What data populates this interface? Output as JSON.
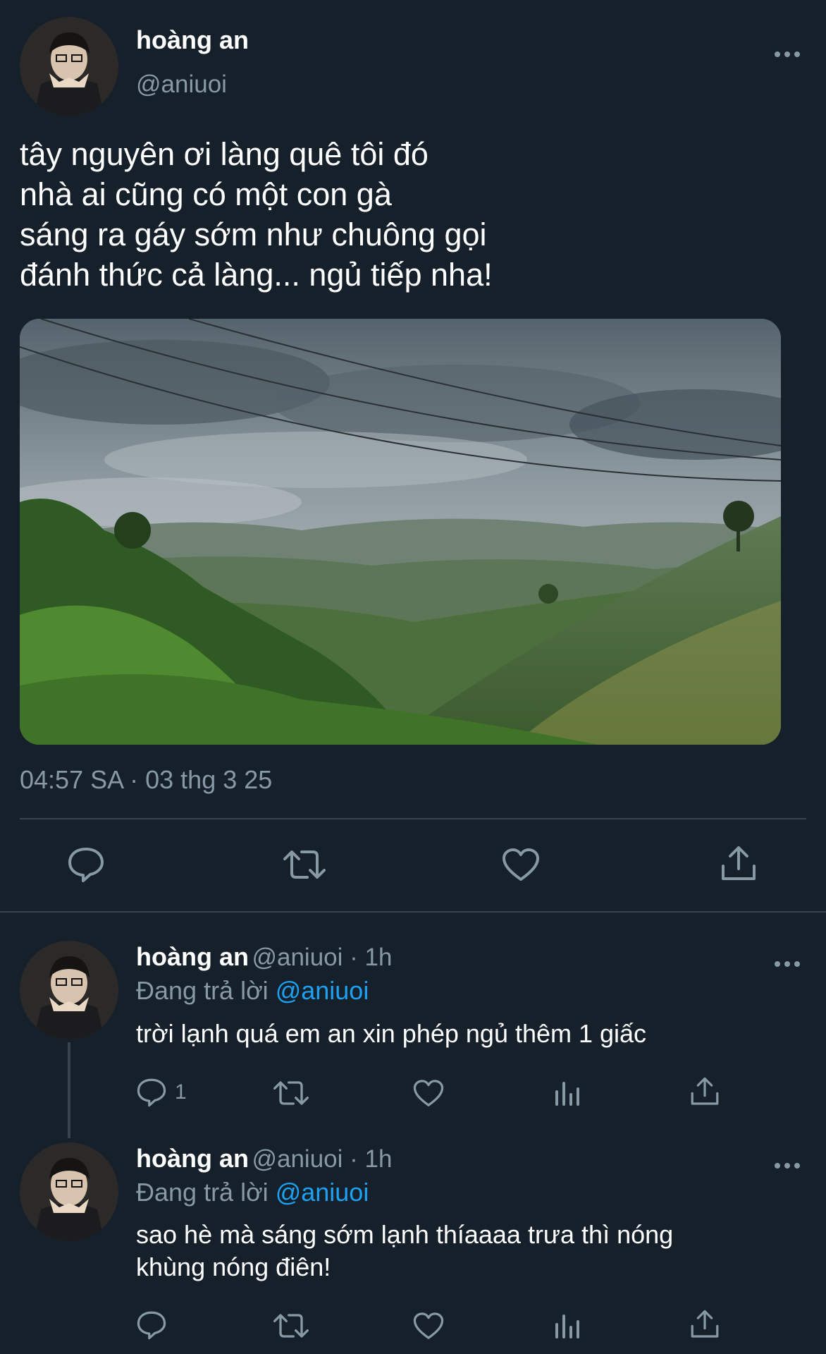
{
  "main_tweet": {
    "author_name": "hoàng an",
    "author_handle": "@aniuoi",
    "text": "tây nguyên ơi làng quê tôi đó\nnhà ai cũng có một con gà\nsáng ra gáy sớm như chuông gọi\nđánh thức cả làng... ngủ tiếp nha!",
    "timestamp": "04:57 SA · 03 thg 3 25",
    "actions": [
      "comment-icon",
      "retweet-icon",
      "heart-icon",
      "share-icon"
    ]
  },
  "replies": [
    {
      "author_name": "hoàng an",
      "author_handle": "@aniuoi · 1h",
      "replying_prefix": "Đang trả lời",
      "replying_to": "@aniuoi",
      "text": "trời lạnh quá em an xin phép ngủ thêm 1 giấc",
      "reply_count": "1"
    },
    {
      "author_name": "hoàng an",
      "author_handle": "@aniuoi · 1h",
      "replying_prefix": "Đang trả lời",
      "replying_to": "@aniuoi",
      "text": "sao hè mà sáng sớm lạnh thíaaaa trưa thì nóng\nkhùng nóng điên!",
      "reply_count": ""
    }
  ],
  "colors": {
    "background": "#15202b",
    "secondary_text": "#8899a6",
    "accent": "#1da1f2",
    "divider": "#38444d"
  }
}
